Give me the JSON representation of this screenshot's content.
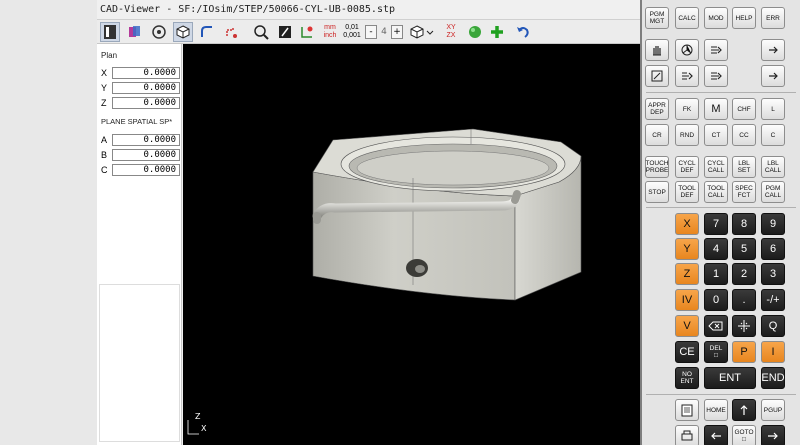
{
  "app": {
    "title": "CAD-Viewer - SF:/IOsim/STEP/50066-CYL-UB-0085.stp",
    "close_glyph": "✕"
  },
  "toolbar": {
    "unit_label": "mm\ninch",
    "precision_label": "0,01\n0,001",
    "minus": "-",
    "value": "4",
    "plus": "+",
    "plane_label": "XY\nZX"
  },
  "sidepanel": {
    "plan_label": "Plan",
    "coords": [
      {
        "name": "X",
        "value": "0.0000"
      },
      {
        "name": "Y",
        "value": "0.0000"
      },
      {
        "name": "Z",
        "value": "0.0000"
      }
    ],
    "plane_label": "PLANE SPATIAL SP*",
    "angles": [
      {
        "name": "A",
        "value": "0.0000"
      },
      {
        "name": "B",
        "value": "0.0000"
      },
      {
        "name": "C",
        "value": "0.0000"
      }
    ]
  },
  "axis_triad": {
    "z": "Z",
    "x": "X"
  },
  "colors": {
    "accent_orange": "#e8861f",
    "viewport_bg": "#000000",
    "part_gray": "#c9c9c2"
  },
  "panel": {
    "row1": [
      "PGM\nMGT",
      "CALC",
      "MOD",
      "HELP",
      "ERR"
    ],
    "row4": [
      "APPR\nDEP",
      "FK",
      "M",
      "CHF",
      "L"
    ],
    "row5": [
      "CR",
      "RND",
      "CT",
      "CC",
      "C"
    ],
    "row6": [
      "TOUCH\nPROBE",
      "CYCL\nDEF",
      "CYCL\nCALL",
      "LBL\nSET",
      "LBL\nCALL"
    ],
    "row7": [
      "STOP",
      "TOOL\nDEF",
      "TOOL\nCALL",
      "SPEC\nFCT",
      "PGM\nCALL"
    ],
    "axis_keys": [
      "X",
      "Y",
      "Z",
      "IV",
      "V"
    ],
    "digits": [
      "7",
      "8",
      "9",
      "4",
      "5",
      "6",
      "1",
      "2",
      "3",
      "0",
      ".",
      "-/+"
    ],
    "q_key": "Q",
    "ce_key": "CE",
    "del_key": "DEL\n□",
    "p_key": "P",
    "i_key": "I",
    "no_ent": "NO\nENT",
    "ent": "ENT",
    "end": "END",
    "home": "HOME",
    "pgup": "PGUP",
    "goto": "GOTO\n□"
  }
}
